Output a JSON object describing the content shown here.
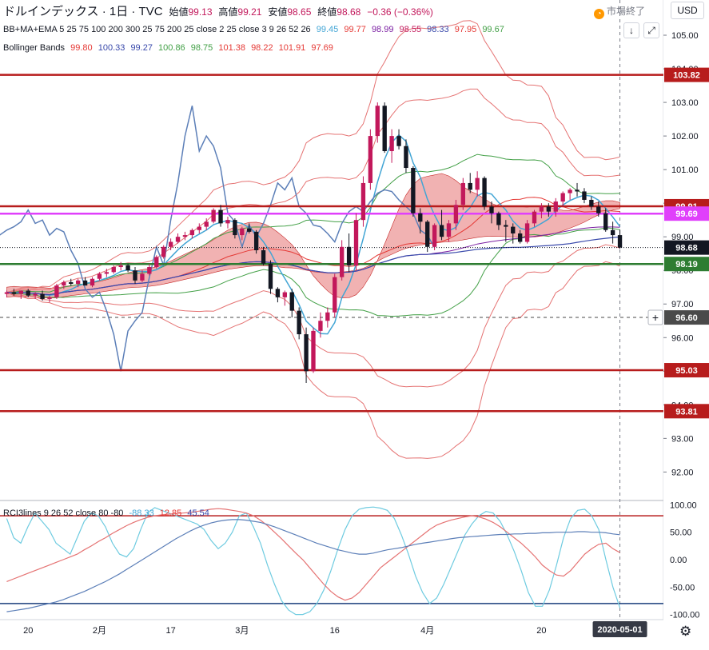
{
  "header": {
    "symbol": "ドルインデックス · 1日 · TVC",
    "open_label": "始値",
    "open": "99.13",
    "high_label": "高値",
    "high": "99.21",
    "low_label": "安値",
    "low": "98.65",
    "close_label": "終値",
    "close": "98.68",
    "change": "−0.36 (−0.36%)",
    "status": "市場終了",
    "currency_button": "USD"
  },
  "indicators": {
    "bb_ma_ema": {
      "label": "BB+MA+EMA 5 25 75 100 200 300 25 75 200 25 close 2 25 close 3 9 26 52 26",
      "values": [
        {
          "v": "99.45",
          "color": "#42a5d5"
        },
        {
          "v": "99.77",
          "color": "#e53935"
        },
        {
          "v": "98.99",
          "color": "#7b1fa2"
        },
        {
          "v": "98.55",
          "color": "#c2185b"
        },
        {
          "v": "98.33",
          "color": "#3949ab"
        },
        {
          "v": "97.95",
          "color": "#e53935"
        },
        {
          "v": "99.67",
          "color": "#43a047"
        }
      ]
    },
    "bollinger": {
      "label": "Bollinger Bands",
      "values": [
        {
          "v": "99.80",
          "color": "#e53935"
        },
        {
          "v": "100.33",
          "color": "#3949ab"
        },
        {
          "v": "99.27",
          "color": "#3949ab"
        },
        {
          "v": "100.86",
          "color": "#43a047"
        },
        {
          "v": "98.75",
          "color": "#43a047"
        },
        {
          "v": "101.38",
          "color": "#e53935"
        },
        {
          "v": "98.22",
          "color": "#e53935"
        },
        {
          "v": "101.91",
          "color": "#e53935"
        },
        {
          "v": "97.69",
          "color": "#e53935"
        }
      ]
    },
    "rci": {
      "label": "RCI3lines 9 26 52 close 80 -80",
      "values": [
        {
          "v": "-88.33",
          "color": "#42a5d5"
        },
        {
          "v": "12.85",
          "color": "#e53935"
        },
        {
          "v": "45.54",
          "color": "#3949ab"
        }
      ]
    }
  },
  "icons": {
    "collapse": "arrow-down-icon",
    "maximize": "maximize-icon",
    "settings": "gear-icon",
    "add": "plus-icon"
  },
  "chart_data": [
    {
      "type": "candlestick",
      "title": "ドルインデックス",
      "ylim": [
        91.2,
        106.0
      ],
      "y_ticks": [
        "92.00",
        "93.00",
        "94.00",
        "95.00",
        "96.00",
        "97.00",
        "98.00",
        "99.00",
        "100.00",
        "101.00",
        "102.00",
        "103.00",
        "104.00",
        "105.00"
      ],
      "x_ticks": [
        "20",
        "2月",
        "17",
        "3月",
        "16",
        "4月",
        "20"
      ],
      "x_cursor_label": "2020-05-01",
      "candles": [
        [
          97.3,
          97.4,
          97.2,
          97.35
        ],
        [
          97.35,
          97.45,
          97.25,
          97.3
        ],
        [
          97.3,
          97.4,
          97.15,
          97.4
        ],
        [
          97.4,
          97.45,
          97.2,
          97.25
        ],
        [
          97.25,
          97.35,
          97.15,
          97.3
        ],
        [
          97.3,
          97.4,
          97.1,
          97.15
        ],
        [
          97.15,
          97.25,
          97.05,
          97.2
        ],
        [
          97.2,
          97.6,
          97.15,
          97.55
        ],
        [
          97.55,
          97.7,
          97.45,
          97.65
        ],
        [
          97.65,
          97.75,
          97.55,
          97.6
        ],
        [
          97.6,
          97.75,
          97.5,
          97.7
        ],
        [
          97.7,
          97.8,
          97.6,
          97.55
        ],
        [
          97.55,
          97.8,
          97.5,
          97.75
        ],
        [
          97.75,
          97.95,
          97.7,
          97.9
        ],
        [
          97.9,
          98.05,
          97.8,
          97.95
        ],
        [
          97.95,
          98.15,
          97.9,
          98.1
        ],
        [
          98.1,
          98.25,
          98.0,
          98.15
        ],
        [
          98.15,
          98.2,
          97.95,
          98.0
        ],
        [
          98.0,
          98.1,
          97.6,
          97.7
        ],
        [
          97.7,
          98.0,
          97.65,
          97.9
        ],
        [
          97.9,
          98.2,
          97.85,
          98.1
        ],
        [
          98.1,
          98.45,
          98.05,
          98.4
        ],
        [
          98.4,
          98.75,
          98.35,
          98.7
        ],
        [
          98.7,
          98.95,
          98.6,
          98.85
        ],
        [
          98.85,
          99.1,
          98.8,
          99.0
        ],
        [
          99.0,
          99.15,
          98.9,
          99.05
        ],
        [
          99.05,
          99.25,
          98.95,
          99.2
        ],
        [
          99.2,
          99.4,
          99.1,
          99.3
        ],
        [
          99.3,
          99.55,
          99.2,
          99.45
        ],
        [
          99.45,
          99.85,
          99.4,
          99.8
        ],
        [
          99.8,
          99.95,
          99.3,
          99.4
        ],
        [
          99.4,
          99.6,
          99.25,
          99.5
        ],
        [
          99.5,
          99.55,
          98.95,
          99.05
        ],
        [
          99.05,
          99.3,
          98.9,
          99.25
        ],
        [
          99.25,
          99.4,
          99.1,
          99.15
        ],
        [
          99.15,
          99.2,
          98.5,
          98.6
        ],
        [
          98.6,
          98.7,
          98.15,
          98.2
        ],
        [
          98.2,
          98.3,
          97.3,
          97.45
        ],
        [
          97.45,
          97.5,
          97.05,
          97.2
        ],
        [
          97.2,
          97.4,
          96.95,
          97.35
        ],
        [
          97.35,
          97.45,
          96.6,
          96.8
        ],
        [
          96.8,
          96.9,
          95.95,
          96.1
        ],
        [
          96.1,
          96.3,
          94.65,
          95.0
        ],
        [
          95.0,
          96.3,
          94.95,
          96.2
        ],
        [
          96.2,
          96.75,
          96.0,
          96.5
        ],
        [
          96.5,
          96.9,
          96.3,
          96.75
        ],
        [
          96.75,
          97.9,
          96.6,
          97.8
        ],
        [
          97.8,
          98.9,
          97.7,
          98.7
        ],
        [
          98.7,
          99.1,
          97.95,
          98.15
        ],
        [
          98.15,
          99.7,
          98.0,
          99.5
        ],
        [
          99.5,
          100.8,
          99.3,
          100.6
        ],
        [
          100.6,
          102.2,
          100.4,
          102.0
        ],
        [
          102.0,
          103.0,
          101.8,
          102.9
        ],
        [
          102.9,
          103.0,
          101.5,
          101.55
        ],
        [
          101.55,
          102.2,
          101.2,
          102.0
        ],
        [
          102.0,
          102.2,
          101.6,
          101.7
        ],
        [
          101.7,
          101.9,
          100.9,
          101.05
        ],
        [
          101.05,
          101.1,
          99.6,
          99.7
        ],
        [
          99.7,
          99.85,
          99.1,
          99.45
        ],
        [
          99.45,
          99.5,
          98.55,
          98.7
        ],
        [
          98.7,
          99.4,
          98.6,
          99.35
        ],
        [
          99.35,
          99.8,
          98.9,
          99.0
        ],
        [
          99.0,
          99.5,
          98.85,
          99.4
        ],
        [
          99.4,
          100.1,
          99.2,
          99.95
        ],
        [
          99.95,
          100.75,
          99.8,
          100.6
        ],
        [
          100.6,
          100.9,
          100.3,
          100.4
        ],
        [
          100.4,
          100.95,
          100.2,
          100.75
        ],
        [
          100.75,
          100.8,
          99.8,
          99.9
        ],
        [
          99.9,
          100.05,
          99.4,
          99.7
        ],
        [
          99.7,
          99.75,
          99.2,
          99.35
        ],
        [
          99.35,
          99.5,
          98.85,
          99.3
        ],
        [
          99.3,
          99.4,
          98.8,
          99.1
        ],
        [
          99.1,
          99.2,
          98.8,
          98.85
        ],
        [
          98.85,
          99.5,
          98.8,
          99.4
        ],
        [
          99.4,
          99.8,
          99.3,
          99.75
        ],
        [
          99.75,
          100.0,
          99.55,
          99.9
        ],
        [
          99.9,
          100.0,
          99.6,
          99.75
        ],
        [
          99.75,
          100.15,
          99.6,
          100.05
        ],
        [
          100.05,
          100.35,
          99.9,
          100.3
        ],
        [
          100.3,
          100.45,
          100.1,
          100.4
        ],
        [
          100.4,
          100.6,
          100.2,
          100.35
        ],
        [
          100.35,
          100.45,
          100.0,
          100.1
        ],
        [
          100.1,
          100.2,
          99.8,
          99.9
        ],
        [
          99.9,
          100.05,
          99.6,
          99.7
        ],
        [
          99.7,
          99.85,
          99.15,
          99.2
        ],
        [
          99.2,
          99.45,
          98.8,
          99.05
        ],
        [
          99.05,
          99.21,
          98.65,
          98.68
        ]
      ],
      "horizontal_lines": [
        {
          "value": 103.82,
          "label": "103.82",
          "color": "#b71c1c"
        },
        {
          "value": 99.91,
          "label": "99.91",
          "color": "#b71c1c"
        },
        {
          "value": 99.69,
          "label": "99.69",
          "color": "#e040fb"
        },
        {
          "value": 98.19,
          "label": "98.19",
          "color": "#2e7d32"
        },
        {
          "value": 96.6,
          "label": "96.60",
          "color": "#4a4a4a",
          "dashed": true
        },
        {
          "value": 95.03,
          "label": "95.03",
          "color": "#b71c1c"
        },
        {
          "value": 93.81,
          "label": "93.81",
          "color": "#b71c1c"
        }
      ],
      "last_price": {
        "value": 98.68,
        "label": "98.68"
      }
    },
    {
      "type": "line",
      "title": "RCI3lines 9 26 52 close 80 -80",
      "ylim": [
        -105,
        105
      ],
      "y_ticks": [
        "100.00",
        "50.00",
        "0.00",
        "-50.00",
        "-100.00"
      ],
      "levels": [
        80,
        -80
      ],
      "series": [
        {
          "name": "RCI 9",
          "color": "#6ecbe0",
          "values": [
            75,
            40,
            30,
            60,
            85,
            70,
            55,
            30,
            20,
            10,
            40,
            70,
            85,
            80,
            60,
            30,
            10,
            5,
            20,
            55,
            85,
            95,
            90,
            85,
            80,
            75,
            70,
            65,
            55,
            35,
            20,
            30,
            50,
            80,
            85,
            60,
            30,
            -10,
            -45,
            -75,
            -92,
            -100,
            -100,
            -95,
            -80,
            -55,
            -20,
            20,
            55,
            80,
            92,
            95,
            96,
            94,
            90,
            75,
            45,
            10,
            -30,
            -60,
            -80,
            -70,
            -45,
            -15,
            15,
            45,
            65,
            80,
            88,
            85,
            70,
            45,
            15,
            -20,
            -60,
            -85,
            -85,
            -55,
            -10,
            40,
            75,
            90,
            92,
            80,
            55,
            0,
            -50,
            -88
          ]
        },
        {
          "name": "RCI 26",
          "color": "#e57373",
          "values": [
            -40,
            -35,
            -30,
            -25,
            -20,
            -15,
            -10,
            -5,
            0,
            5,
            10,
            18,
            25,
            33,
            40,
            48,
            55,
            62,
            68,
            73,
            77,
            80,
            82,
            83,
            84,
            85,
            86,
            88,
            90,
            92,
            93,
            92,
            90,
            88,
            85,
            80,
            72,
            62,
            50,
            38,
            25,
            12,
            0,
            -15,
            -30,
            -45,
            -58,
            -68,
            -74,
            -70,
            -60,
            -45,
            -30,
            -15,
            -5,
            5,
            15,
            25,
            35,
            45,
            55,
            63,
            68,
            72,
            75,
            78,
            80,
            78,
            74,
            68,
            60,
            50,
            40,
            30,
            18,
            5,
            -10,
            -20,
            -28,
            -30,
            -20,
            -5,
            10,
            20,
            28,
            30,
            20,
            12.85
          ]
        },
        {
          "name": "RCI 52",
          "color": "#5c7fb8",
          "values": [
            -95,
            -93,
            -91,
            -89,
            -86,
            -83,
            -80,
            -77,
            -73,
            -68,
            -63,
            -58,
            -52,
            -46,
            -40,
            -33,
            -26,
            -18,
            -10,
            -2,
            6,
            14,
            22,
            30,
            38,
            45,
            52,
            58,
            63,
            67,
            70,
            72,
            73,
            73,
            72,
            70,
            68,
            64,
            60,
            55,
            50,
            45,
            40,
            35,
            30,
            26,
            22,
            18,
            15,
            12,
            10,
            10,
            12,
            15,
            18,
            20,
            22,
            25,
            28,
            30,
            32,
            34,
            36,
            38,
            40,
            41,
            42,
            43,
            44,
            45,
            46,
            46,
            47,
            47,
            48,
            48,
            49,
            49,
            50,
            50,
            50,
            51,
            51,
            50,
            50,
            49,
            47,
            45.54
          ]
        }
      ]
    }
  ]
}
